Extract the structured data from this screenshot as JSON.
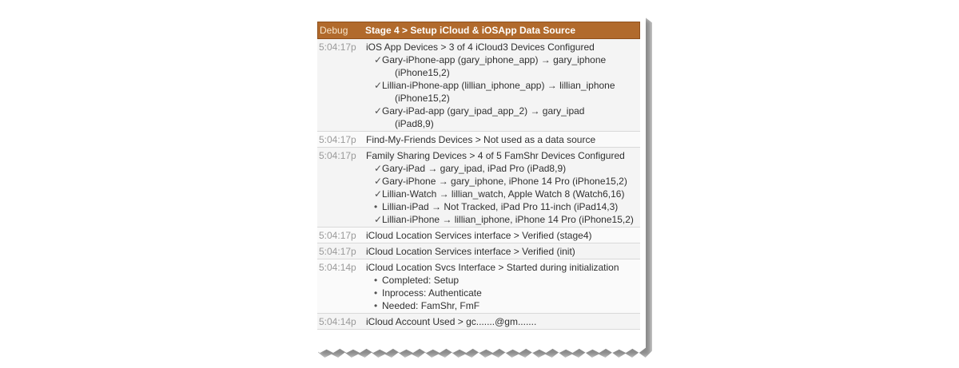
{
  "header": {
    "level": "Debug",
    "title": "Stage 4 > Setup iCloud & iOSApp Data Source"
  },
  "entries": [
    {
      "time": "5:04:17p",
      "text": "iOS App Devices > 3 of 4 iCloud3 Devices Configured",
      "items": [
        {
          "mark": "✓",
          "line1": "Gary-iPhone-app (gary_iphone_app) → gary_iphone",
          "line2": "(iPhone15,2)"
        },
        {
          "mark": "✓",
          "line1": "Lillian-iPhone-app (lillian_iphone_app) → lillian_iphone",
          "line2": "(iPhone15,2)"
        },
        {
          "mark": "✓",
          "line1": "Gary-iPad-app (gary_ipad_app_2) → gary_ipad",
          "line2": "(iPad8,9)"
        }
      ]
    },
    {
      "time": "5:04:17p",
      "text": "Find-My-Friends Devices > Not used as a data source",
      "items": []
    },
    {
      "time": "5:04:17p",
      "text": "Family Sharing Devices > 4 of 5 FamShr Devices Configured",
      "items": [
        {
          "mark": "✓",
          "line1": "Gary-iPad → gary_ipad, iPad Pro (iPad8,9)"
        },
        {
          "mark": "✓",
          "line1": "Gary-iPhone → gary_iphone, iPhone 14 Pro (iPhone15,2)"
        },
        {
          "mark": "✓",
          "line1": "Lillian-Watch → lillian_watch, Apple Watch 8 (Watch6,16)"
        },
        {
          "mark": "•",
          "line1": "Lillian-iPad → Not Tracked, iPad Pro 11-inch (iPad14,3)"
        },
        {
          "mark": "✓",
          "line1": "Lillian-iPhone → lillian_iphone, iPhone 14 Pro (iPhone15,2)"
        }
      ]
    },
    {
      "time": "5:04:17p",
      "text": "iCloud Location Services interface > Verified (stage4)",
      "items": []
    },
    {
      "time": "5:04:17p",
      "text": "iCloud Location Services interface > Verified (init)",
      "items": []
    },
    {
      "time": "5:04:14p",
      "text": "iCloud Location Svcs Interface > Started during initialization",
      "items": [
        {
          "mark": "•",
          "line1": "Completed: Setup"
        },
        {
          "mark": "•",
          "line1": "Inprocess: Authenticate"
        },
        {
          "mark": "•",
          "line1": "Needed: FamShr, FmF"
        }
      ]
    },
    {
      "time": "5:04:14p",
      "text": "iCloud Account Used > gc.......@gm.......",
      "items": []
    }
  ]
}
